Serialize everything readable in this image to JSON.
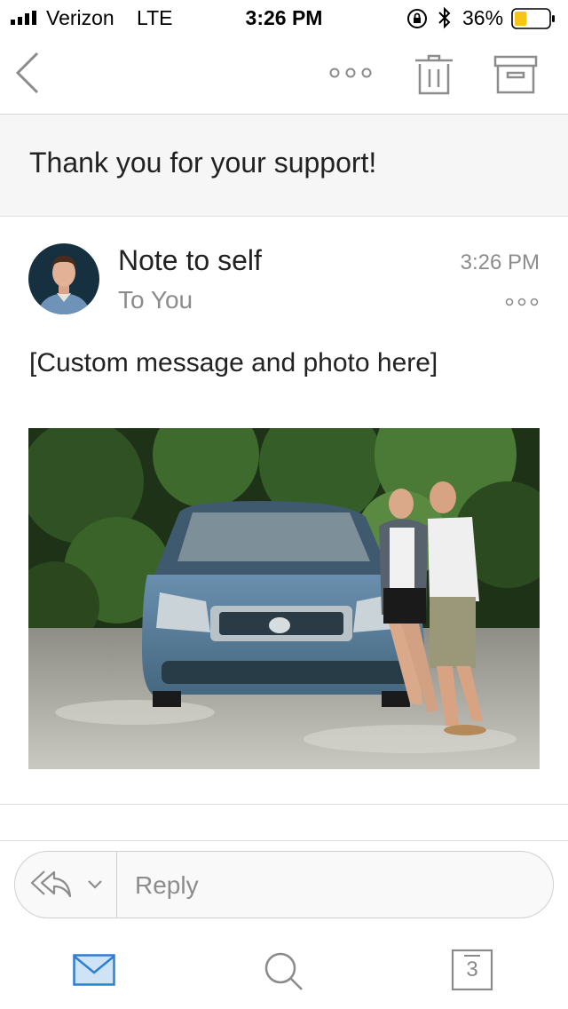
{
  "status_bar": {
    "carrier": "Verizon",
    "network": "LTE",
    "time": "3:26 PM",
    "battery_percent": "36%",
    "battery_level": 0.36,
    "battery_color": "#f5c518",
    "icons": [
      "signal-icon",
      "rotation-lock-icon",
      "bluetooth-icon",
      "battery-icon"
    ]
  },
  "toolbar": {
    "icons": [
      "back-chevron-icon",
      "more-icon",
      "trash-icon",
      "archive-icon"
    ]
  },
  "email": {
    "subject": "Thank you for your support!",
    "sender": "Note to self",
    "recipient": "To You",
    "time": "3:26 PM",
    "body": "[Custom message and photo here]"
  },
  "reply": {
    "placeholder": "Reply",
    "icons": [
      "reply-all-icon",
      "chevron-down-icon"
    ]
  },
  "tabs": {
    "calendar_day": "3",
    "active": "mail",
    "accent_color": "#2f7fd0",
    "icons": [
      "mail-icon",
      "search-icon",
      "calendar-icon"
    ]
  }
}
